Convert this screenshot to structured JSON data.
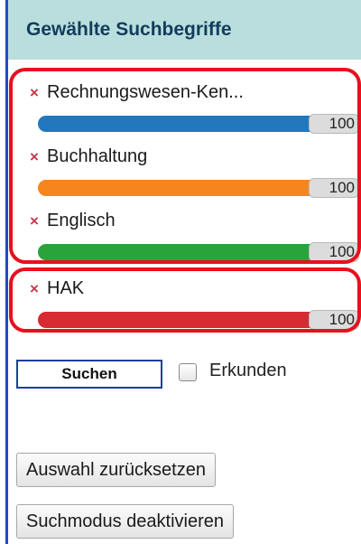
{
  "panel": {
    "title": "Gewählte Suchbegriffe"
  },
  "terms": [
    {
      "label": "Rechnungswesen-Ken...",
      "value": "100",
      "level": 100,
      "color": "#2178bd",
      "remove": "×"
    },
    {
      "label": "Buchhaltung",
      "value": "100",
      "level": 100,
      "color": "#f7851e",
      "remove": "×"
    },
    {
      "label": "Englisch",
      "value": "100",
      "level": 100,
      "color": "#2aa33a",
      "remove": "×"
    },
    {
      "label": "HAK",
      "value": "100",
      "level": 100,
      "color": "#d72a31",
      "remove": "×"
    }
  ],
  "actions": {
    "search_label": "Suchen",
    "explore_label": "Erkunden",
    "explore_checked": false,
    "reset_label": "Auswahl zurücksetzen",
    "deactivate_label": "Suchmodus deaktivieren"
  },
  "colors": {
    "header_bg": "#b9dedd",
    "highlight": "#e8101c",
    "remove_icon": "#c0394b"
  }
}
